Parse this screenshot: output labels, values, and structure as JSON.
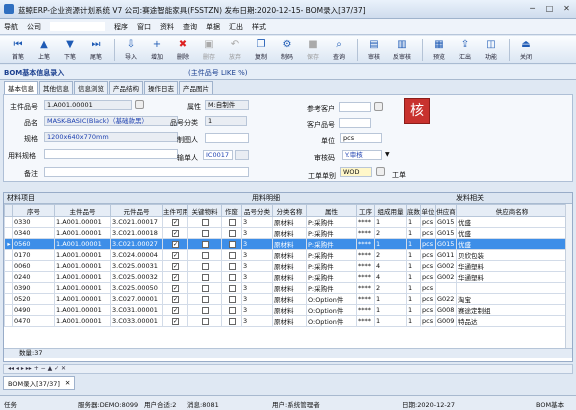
{
  "window": {
    "title": "蓝鲸ERP-企业资源计划系统 V7 公司:赛途智能家具(FSSTZN) 发布日期:2020-12-15- BOM录入[37/37]"
  },
  "menu": {
    "items": [
      "导航",
      "公司",
      "程序",
      "窗口",
      "资料",
      "查询",
      "单据",
      "汇出",
      "样式"
    ]
  },
  "toolbar": {
    "buttons": [
      "首笔",
      "上笔",
      "下笔",
      "尾笔",
      "导入",
      "增加",
      "删除",
      "删存",
      "放弃",
      "复制",
      "制码",
      "保存",
      "查询",
      "审核",
      "反审核",
      "预览",
      "汇出",
      "功能",
      "关闭"
    ]
  },
  "header": {
    "title": "BOM基本信息录入",
    "subtitle": "(主件品号 LIKE %)"
  },
  "tabs": [
    "基本信息",
    "其他信息",
    "信息浏览",
    "产品结构",
    "操作日志",
    "产品图片"
  ],
  "form": {
    "main_item_label": "主件品号",
    "main_item": "1.A001.00001",
    "attr_label": "属性",
    "attr": "M:自制件",
    "ref_customer_label": "参考客户",
    "name_label": "品名",
    "name": "MASK-BASIC(Black)（基础款黑）",
    "category_label": "品号分类",
    "category": "1",
    "cust_item_label": "客户品号",
    "spec_label": "规格",
    "spec": "1200x640x770mm",
    "creator_label": "制图人",
    "unit_label": "单位",
    "unit": "pcs",
    "material_spec_label": "用料规格",
    "entry_label": "输单人",
    "entry": "IC0017",
    "audit_label": "审核码",
    "audit": "Y.审核",
    "remark_label": "备注",
    "order_type_label": "工单单别",
    "order_type": "WOD",
    "order_type2": "工单",
    "seal": "核"
  },
  "grid": {
    "groups": [
      "材料项目",
      "用料明细",
      "发料相关"
    ],
    "columns": [
      "序号",
      "主件品号",
      "元件品号",
      "主件可用",
      "关键物料",
      "作废",
      "品号分类",
      "分类名称",
      "属性",
      "工序",
      "组成用量",
      "底数",
      "单位",
      "供应商",
      "供应商名称"
    ],
    "rows": [
      {
        "seq": "0330",
        "main": "1.A001.00001",
        "comp": "3.C021.00017",
        "avail": true,
        "key": false,
        "void": false,
        "cat": "3",
        "catname": "原材料",
        "attr": "P:采购件",
        "op": "****",
        "qty": "1",
        "base": "1",
        "unit": "pcs",
        "sup": "G015",
        "supname": "优盛"
      },
      {
        "seq": "0340",
        "main": "1.A001.00001",
        "comp": "3.C021.00018",
        "avail": true,
        "key": false,
        "void": false,
        "cat": "3",
        "catname": "原材料",
        "attr": "P:采购件",
        "op": "****",
        "qty": "2",
        "base": "1",
        "unit": "pcs",
        "sup": "G015",
        "supname": "优盛"
      },
      {
        "seq": "0560",
        "main": "1.A001.00001",
        "comp": "3.C021.00027",
        "avail": true,
        "key": false,
        "void": false,
        "cat": "3",
        "catname": "原材料",
        "attr": "P:采购件",
        "op": "****",
        "qty": "1",
        "base": "1",
        "unit": "pcs",
        "sup": "G015",
        "supname": "优盛"
      },
      {
        "seq": "0170",
        "main": "1.A001.00001",
        "comp": "3.C024.00004",
        "avail": true,
        "key": false,
        "void": false,
        "cat": "3",
        "catname": "原材料",
        "attr": "P:采购件",
        "op": "****",
        "qty": "2",
        "base": "1",
        "unit": "pcs",
        "sup": "G011",
        "supname": "贝欣包装"
      },
      {
        "seq": "0060",
        "main": "1.A001.00001",
        "comp": "3.C025.00031",
        "avail": true,
        "key": false,
        "void": false,
        "cat": "3",
        "catname": "原材料",
        "attr": "P:采购件",
        "op": "****",
        "qty": "4",
        "base": "1",
        "unit": "pcs",
        "sup": "G002",
        "supname": "华通塑料"
      },
      {
        "seq": "0240",
        "main": "1.A001.00001",
        "comp": "3.C025.00032",
        "avail": true,
        "key": false,
        "void": false,
        "cat": "3",
        "catname": "原材料",
        "attr": "P:采购件",
        "op": "****",
        "qty": "4",
        "base": "1",
        "unit": "pcs",
        "sup": "G002",
        "supname": "华通塑料"
      },
      {
        "seq": "0390",
        "main": "1.A001.00001",
        "comp": "3.C025.00050",
        "avail": true,
        "key": false,
        "void": false,
        "cat": "3",
        "catname": "原材料",
        "attr": "P:采购件",
        "op": "****",
        "qty": "2",
        "base": "1",
        "unit": "pcs",
        "sup": "",
        "supname": ""
      },
      {
        "seq": "0520",
        "main": "1.A001.00001",
        "comp": "3.C027.00001",
        "avail": true,
        "key": false,
        "void": false,
        "cat": "3",
        "catname": "原材料",
        "attr": "O:Option件",
        "op": "****",
        "qty": "1",
        "base": "1",
        "unit": "pcs",
        "sup": "G022",
        "supname": "淘宝"
      },
      {
        "seq": "0490",
        "main": "1.A001.00001",
        "comp": "3.C031.00001",
        "avail": true,
        "key": false,
        "void": false,
        "cat": "3",
        "catname": "原材料",
        "attr": "O:Option件",
        "op": "****",
        "qty": "1",
        "base": "1",
        "unit": "pcs",
        "sup": "G008",
        "supname": "赛途定制组"
      },
      {
        "seq": "0470",
        "main": "1.A001.00001",
        "comp": "3.C033.00001",
        "avail": true,
        "key": false,
        "void": false,
        "cat": "3",
        "catname": "原材料",
        "attr": "O:Option件",
        "op": "****",
        "qty": "1",
        "base": "1",
        "unit": "pcs",
        "sup": "G009",
        "supname": "特品达"
      }
    ],
    "selected_index": 2,
    "count": "数量:37"
  },
  "bottom_tab": "BOM录入[37/37]",
  "status": {
    "task": "任务",
    "server": "服务器:DEMO:8099",
    "users": "用户合适:2",
    "messages": "消息:8081",
    "user": "用户:系统管理者",
    "date": "日期:2020-12-27",
    "right": "BOM基本"
  },
  "colors": {
    "selected_row": "#3d8ee8",
    "seal": "#c8322e",
    "header_text": "#1b3f8f"
  }
}
